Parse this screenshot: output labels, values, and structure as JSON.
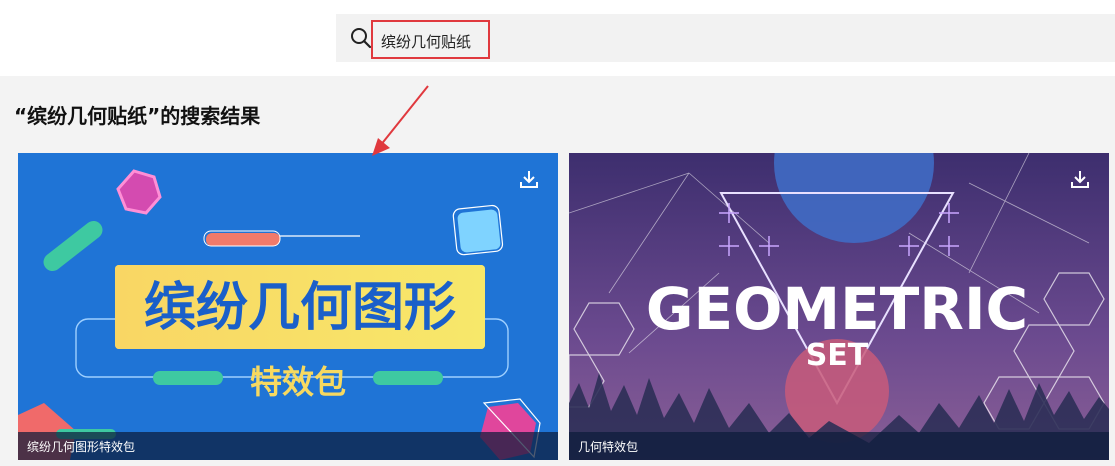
{
  "search": {
    "icon": "search-icon",
    "query": "缤纷几何贴纸"
  },
  "results": {
    "title": "“缤纷几何贴纸”的搜索结果"
  },
  "cards": [
    {
      "caption": "缤纷几何图形特效包",
      "art_title": "缤纷几何图形",
      "art_subtitle": "特效包",
      "download_icon": "download-icon"
    },
    {
      "caption": "几何特效包",
      "art_title": "GEOMETRIC",
      "art_subtitle": "SET",
      "download_icon": "download-icon"
    }
  ],
  "colors": {
    "highlight_border": "#e0393e",
    "card1_background": "#1f74d6",
    "card2_background": "#5a3f86"
  }
}
